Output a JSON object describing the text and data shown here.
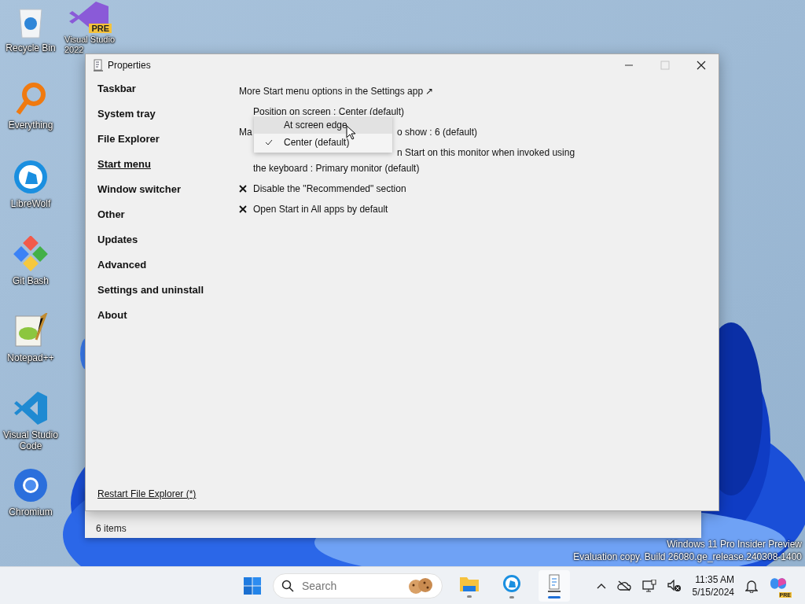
{
  "desktop_icons": [
    {
      "kind": "recycle",
      "lines": [
        "Recycle Bin"
      ]
    },
    {
      "kind": "search",
      "lines": [
        "Everything"
      ]
    },
    {
      "kind": "wolf",
      "lines": [
        "LibreWolf"
      ]
    },
    {
      "kind": "git",
      "lines": [
        "Git Bash"
      ]
    },
    {
      "kind": "notepad",
      "lines": [
        "Notepad++"
      ]
    },
    {
      "kind": "vscode",
      "lines": [
        "Visual Studio",
        "Code"
      ]
    },
    {
      "kind": "chromium",
      "lines": [
        "Chromium"
      ]
    }
  ],
  "desktop_icon_column2": {
    "kind": "vs",
    "badge": "PRE",
    "lines": [
      "Visual Studio",
      "2022"
    ]
  },
  "explorer_window": {
    "status_bar": "6 items"
  },
  "properties_window": {
    "title": "Properties",
    "nav": [
      {
        "label": "Taskbar",
        "selected": false
      },
      {
        "label": "System tray",
        "selected": false
      },
      {
        "label": "File Explorer",
        "selected": false
      },
      {
        "label": "Start menu",
        "selected": true
      },
      {
        "label": "Window switcher",
        "selected": false
      },
      {
        "label": "Other",
        "selected": false
      },
      {
        "label": "Updates",
        "selected": false
      },
      {
        "label": "Advanced",
        "selected": false
      },
      {
        "label": "Settings and uninstall",
        "selected": false
      },
      {
        "label": "About",
        "selected": false
      }
    ],
    "settings": [
      {
        "kind": "link",
        "text": "More Start menu options in the Settings app ↗"
      },
      {
        "kind": "choice",
        "text": "Position on screen : Center (default)"
      },
      {
        "kind": "covered",
        "lead": "Ma",
        "rest": "o show : 6 (default)"
      },
      {
        "kind": "covered_wrapped",
        "lines": [
          "n Start on this monitor when invoked using",
          "the keyboard : Primary monitor (default)"
        ]
      },
      {
        "kind": "toggle",
        "on": false,
        "text": "Disable the \"Recommended\" section"
      },
      {
        "kind": "toggle",
        "on": false,
        "text": "Open Start in All apps by default"
      }
    ],
    "dropdown": [
      {
        "label": "At screen edge",
        "hovered": true,
        "checked": false
      },
      {
        "label": "Center (default)",
        "hovered": false,
        "checked": true
      }
    ],
    "footer_link": "Restart File Explorer (*)"
  },
  "watermark": [
    "Windows 11 Pro Insider Preview",
    "Evaluation copy. Build 26080.ge_release.240308-1400"
  ],
  "taskbar": {
    "search": {
      "placeholder": "Search"
    },
    "apps": [
      {
        "kind": "folder",
        "active": false
      },
      {
        "kind": "wolf",
        "active": false
      },
      {
        "kind": "document",
        "active": true
      }
    ],
    "clock": {
      "time": "11:35 AM",
      "date": "5/15/2024"
    },
    "copilot_badge": "PRE"
  }
}
